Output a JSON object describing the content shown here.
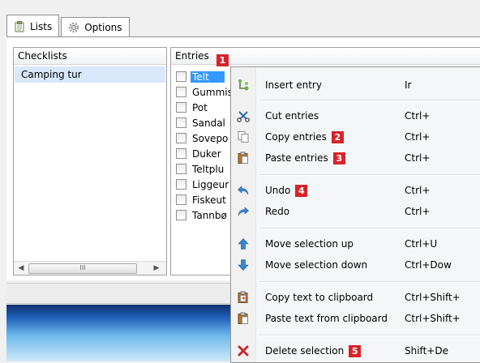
{
  "tabs": [
    {
      "label": "Lists",
      "icon": "clipboard-icon"
    },
    {
      "label": "Options",
      "icon": "gear-icon"
    }
  ],
  "checklists": {
    "header": "Checklists",
    "items": [
      "Camping tur"
    ],
    "scroll_thumb": "III"
  },
  "entries": {
    "header": "Entries",
    "items": [
      "Telt",
      "Gummis",
      "Pot",
      "Sandal",
      "Sovepo",
      "Duker",
      "Teltplu",
      "Liggeur",
      "Fiskeut",
      "Tannbø"
    ],
    "selected_index": 0
  },
  "badges": {
    "b1": "1",
    "b2": "2",
    "b3": "3",
    "b4": "4",
    "b5": "5"
  },
  "menu": {
    "insert": {
      "label": "Insert entry",
      "key": "Ir"
    },
    "cut": {
      "label": "Cut entries",
      "key": "Ctrl+"
    },
    "copy": {
      "label": "Copy entries",
      "key": "Ctrl+"
    },
    "paste": {
      "label": "Paste entries",
      "key": "Ctrl+"
    },
    "undo": {
      "label": "Undo",
      "key": "Ctrl+"
    },
    "redo": {
      "label": "Redo",
      "key": "Ctrl+"
    },
    "move_up": {
      "label": "Move selection up",
      "key": "Ctrl+U"
    },
    "move_down": {
      "label": "Move selection down",
      "key": "Ctrl+Dow"
    },
    "copy_text": {
      "label": "Copy text to clipboard",
      "key": "Ctrl+Shift+"
    },
    "paste_text": {
      "label": "Paste text from clipboard",
      "key": "Ctrl+Shift+"
    },
    "delete": {
      "label": "Delete selection",
      "key": "Shift+De"
    }
  },
  "colors": {
    "badge": "#d8232a",
    "selection": "#3399ff",
    "checklist_selection": "#d9e8fb"
  }
}
